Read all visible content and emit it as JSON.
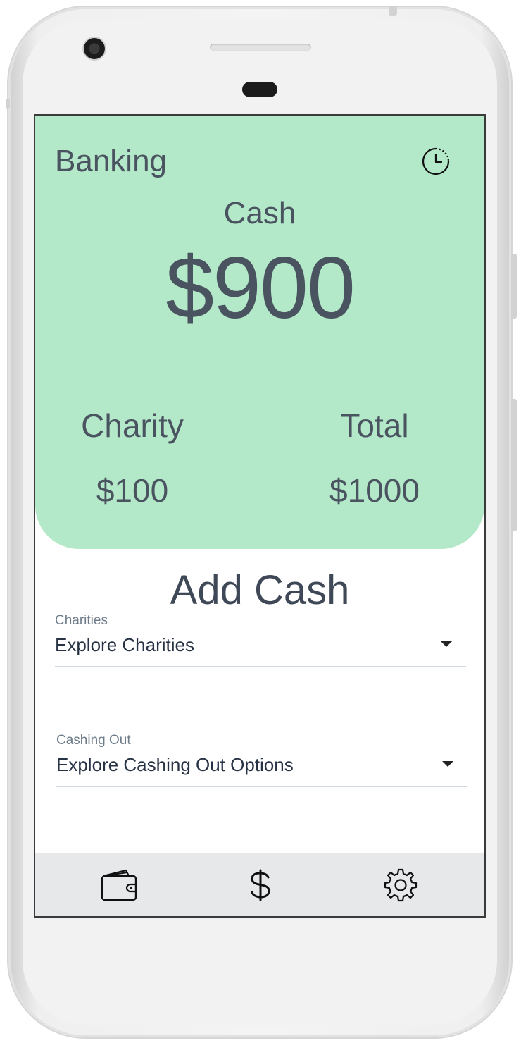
{
  "header": {
    "title": "Banking",
    "history_icon": "history-clock-icon"
  },
  "balance": {
    "cash_label": "Cash",
    "cash_amount": "$900",
    "charity_label": "Charity",
    "charity_amount": "$100",
    "total_label": "Total",
    "total_amount": "$1000"
  },
  "main": {
    "heading": "Add Cash",
    "charities": {
      "label": "Charities",
      "value": "Explore Charities"
    },
    "cashing_out": {
      "label": "Cashing Out",
      "value": "Explore Cashing Out Options"
    }
  },
  "nav": {
    "items": [
      {
        "icon": "wallet-icon"
      },
      {
        "icon": "dollar-icon"
      },
      {
        "icon": "gear-icon"
      }
    ]
  },
  "colors": {
    "hero_bg": "#b3e8c8",
    "text": "#4a5360",
    "nav_bg": "#e7e8ea"
  }
}
